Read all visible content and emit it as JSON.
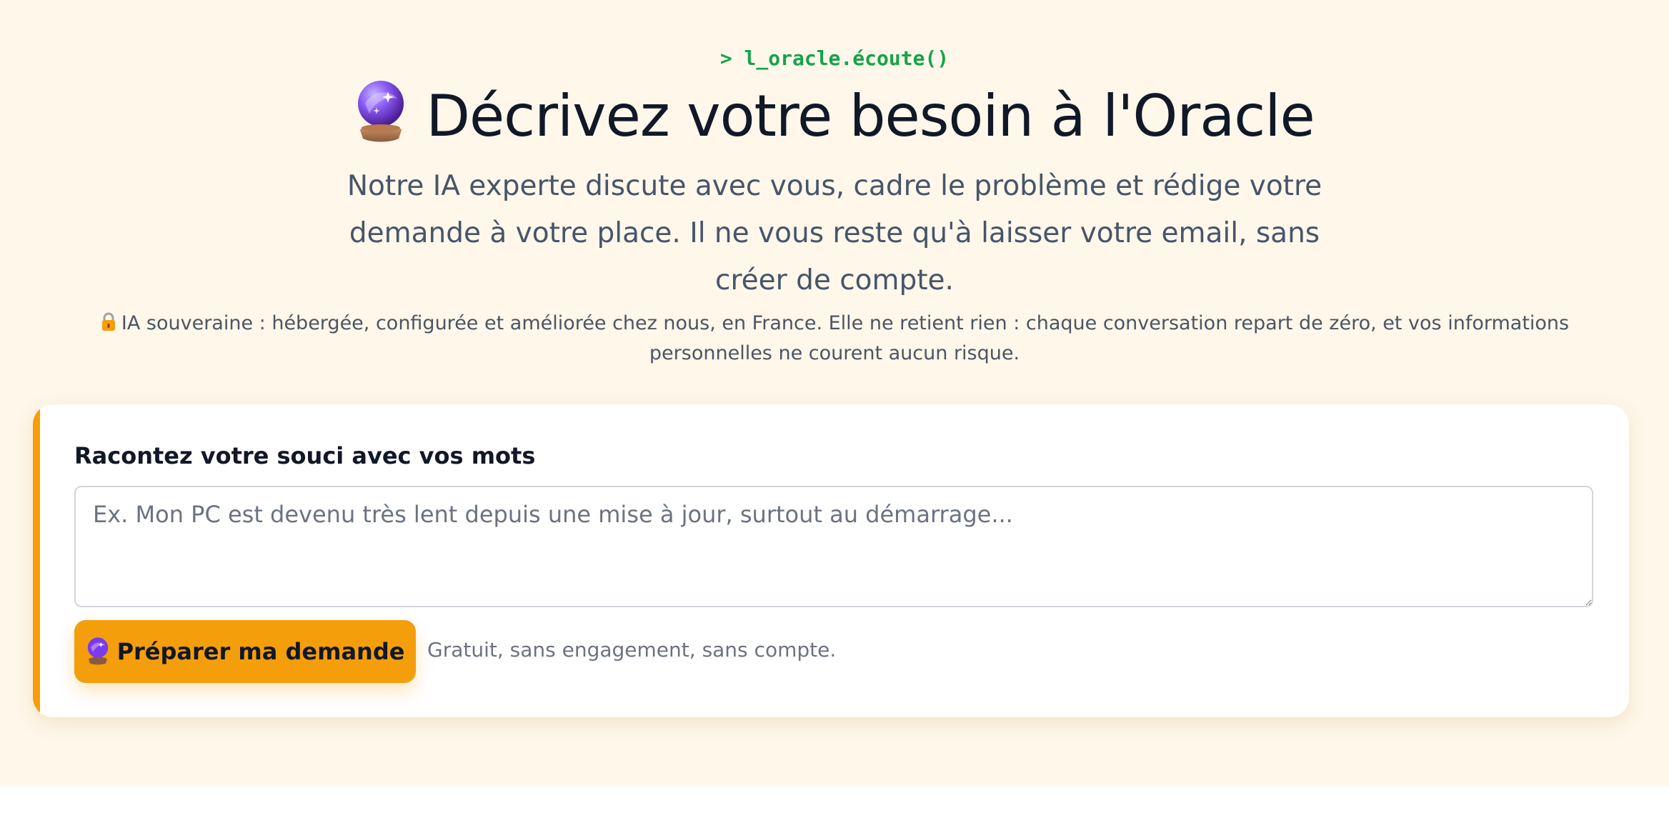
{
  "header": {
    "prompt": "> l_oracle.écoute()",
    "title": "Décrivez votre besoin à l'Oracle",
    "subtitle": "Notre IA experte discute avec vous, cadre le problème et rédige votre demande à votre place. Il ne vous reste qu'à laisser votre email, sans créer de compte.",
    "notice": "IA souveraine : hébergée, configurée et améliorée chez nous, en France. Elle ne retient rien : chaque conversation repart de zéro, et vos informations personnelles ne courent aucun risque."
  },
  "icons": {
    "title_icon": "crystal-ball-icon",
    "notice_icon": "lock-icon",
    "button_icon": "crystal-ball-icon"
  },
  "form": {
    "label": "Racontez votre souci avec vos mots",
    "textarea_value": "",
    "textarea_placeholder": "Ex. Mon PC est devenu très lent depuis une mise à jour, surtout au démarrage...",
    "submit_label": "Préparer ma demande",
    "hint": "Gratuit, sans engagement, sans compte."
  },
  "colors": {
    "accent": "#f59e0b",
    "prompt": "#16a34a",
    "background": "#fef7ea"
  }
}
